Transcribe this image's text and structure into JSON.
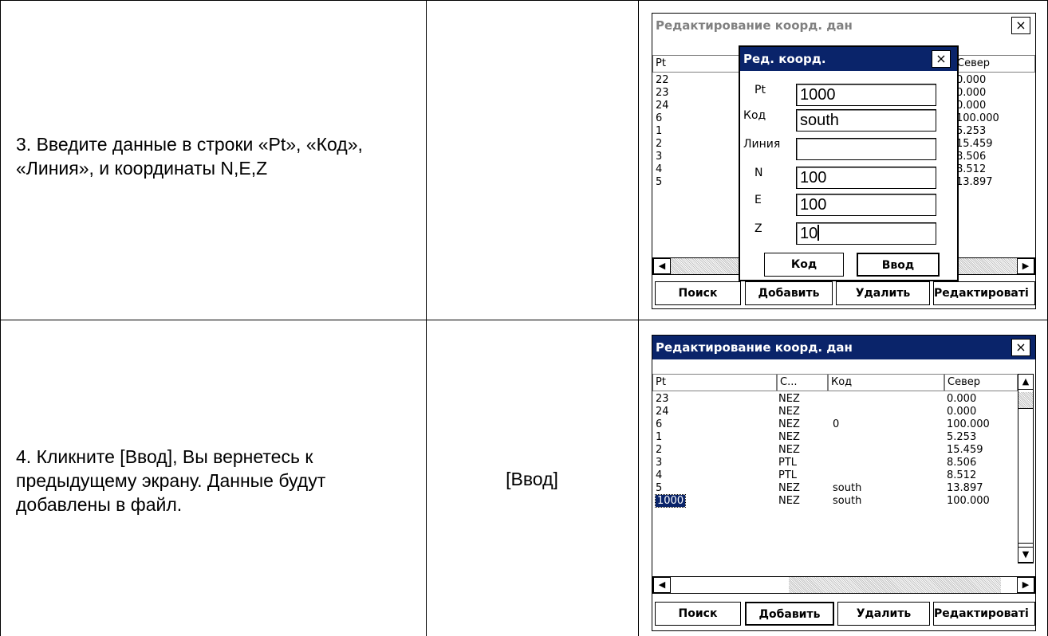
{
  "rows": [
    {
      "step": "3. Введите данные в строки «Pt», «Код», «Линия», и координаты N,E,Z",
      "action": ""
    },
    {
      "step": "4. Кликните [Ввод], Вы вернетесь к предыдущему экрану. Данные будут добавлены в файл.",
      "action": "[Ввод]"
    }
  ],
  "screen1": {
    "title": "Редактирование коорд. дан",
    "close": "×",
    "headers": {
      "pt": "Pt",
      "north": "Север"
    },
    "pt_col": [
      "22",
      "23",
      "24",
      "6",
      "1",
      "2",
      "3",
      "4",
      "5"
    ],
    "north_col": [
      "0.000",
      "0.000",
      "0.000",
      "100.000",
      "5.253",
      "15.459",
      "8.506",
      "8.512",
      "13.897"
    ],
    "dialog": {
      "title": "Ред. коорд.",
      "close": "×",
      "fields": [
        {
          "label": "Pt",
          "value": "1000"
        },
        {
          "label": "Код",
          "value": "south"
        },
        {
          "label": "Линия",
          "value": ""
        },
        {
          "label": "N",
          "value": "100"
        },
        {
          "label": "E",
          "value": "100"
        },
        {
          "label": "Z",
          "value": "10"
        }
      ],
      "buttons": {
        "code": "Код",
        "enter": "Ввод"
      }
    },
    "buttons": {
      "search": "Поиск",
      "add": "Добавить",
      "delete": "Удалить",
      "edit": "Редактироваті"
    }
  },
  "screen2": {
    "title": "Редактирование коорд. дан",
    "close": "×",
    "headers": {
      "pt": "Pt",
      "c": "С...",
      "code": "Код",
      "north": "Север"
    },
    "rows": [
      {
        "pt": "23",
        "c": "NEZ",
        "code": "",
        "north": "0.000"
      },
      {
        "pt": "24",
        "c": "NEZ",
        "code": "",
        "north": "0.000"
      },
      {
        "pt": "6",
        "c": "NEZ",
        "code": "0",
        "north": "100.000"
      },
      {
        "pt": "1",
        "c": "NEZ",
        "code": "",
        "north": "5.253"
      },
      {
        "pt": "2",
        "c": "NEZ",
        "code": "",
        "north": "15.459"
      },
      {
        "pt": "3",
        "c": "PTL",
        "code": "",
        "north": "8.506"
      },
      {
        "pt": "4",
        "c": "PTL",
        "code": "",
        "north": "8.512"
      },
      {
        "pt": "5",
        "c": "NEZ",
        "code": "south",
        "north": "13.897"
      },
      {
        "pt": "1000",
        "c": "NEZ",
        "code": "south",
        "north": "100.000"
      }
    ],
    "buttons": {
      "search": "Поиск",
      "add": "Добавить",
      "delete": "Удалить",
      "edit": "Редактироваті"
    }
  }
}
